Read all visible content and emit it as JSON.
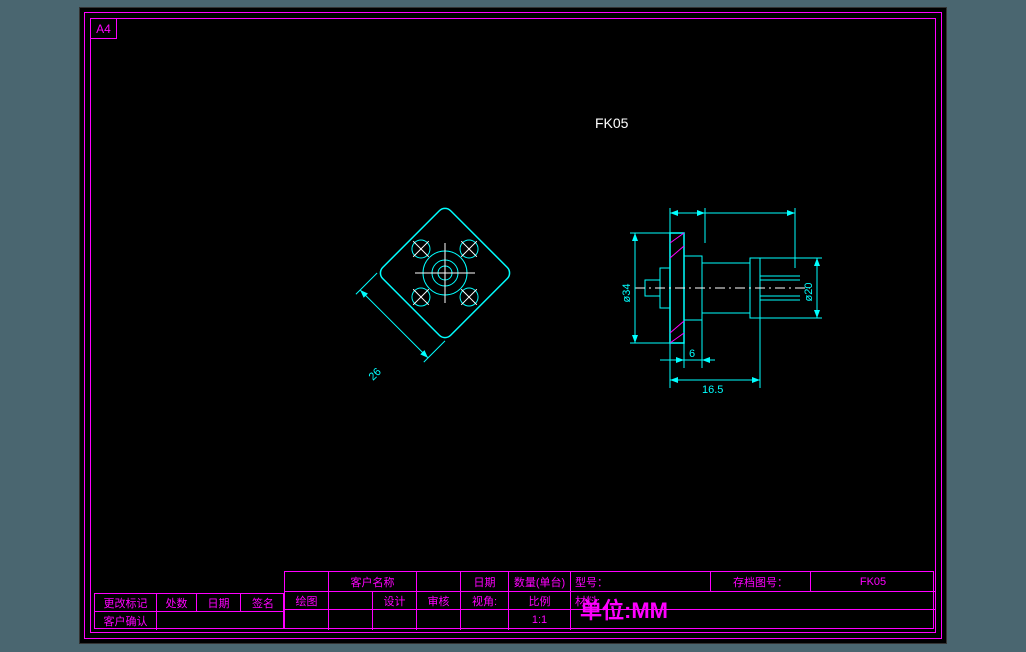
{
  "sheet": {
    "size_label": "A4"
  },
  "part": {
    "label": "FK05"
  },
  "dimensions": {
    "front_size": "26",
    "side_dia1": "ø34",
    "side_dia2": "ø20",
    "side_len1": "6",
    "side_len2": "16.5"
  },
  "titleblock": {
    "left": {
      "row1": {
        "c1": "更改标记",
        "c2": "处数",
        "c3": "日期",
        "c4": "签名"
      },
      "row2": {
        "c1": "客户确认"
      }
    },
    "main": {
      "row1": {
        "c1": "客户名称",
        "c2": "日期",
        "c3": "数量(单台)",
        "c4": "型号：",
        "c5": "存档图号：",
        "c6": "FK05"
      },
      "row2": {
        "c1": "绘图",
        "c2": "设计",
        "c3": "审核",
        "c4": "视角:",
        "c5": "比例",
        "c6": "材料:"
      },
      "row3": {
        "c5": "1:1"
      }
    },
    "unit": "单位:MM"
  }
}
